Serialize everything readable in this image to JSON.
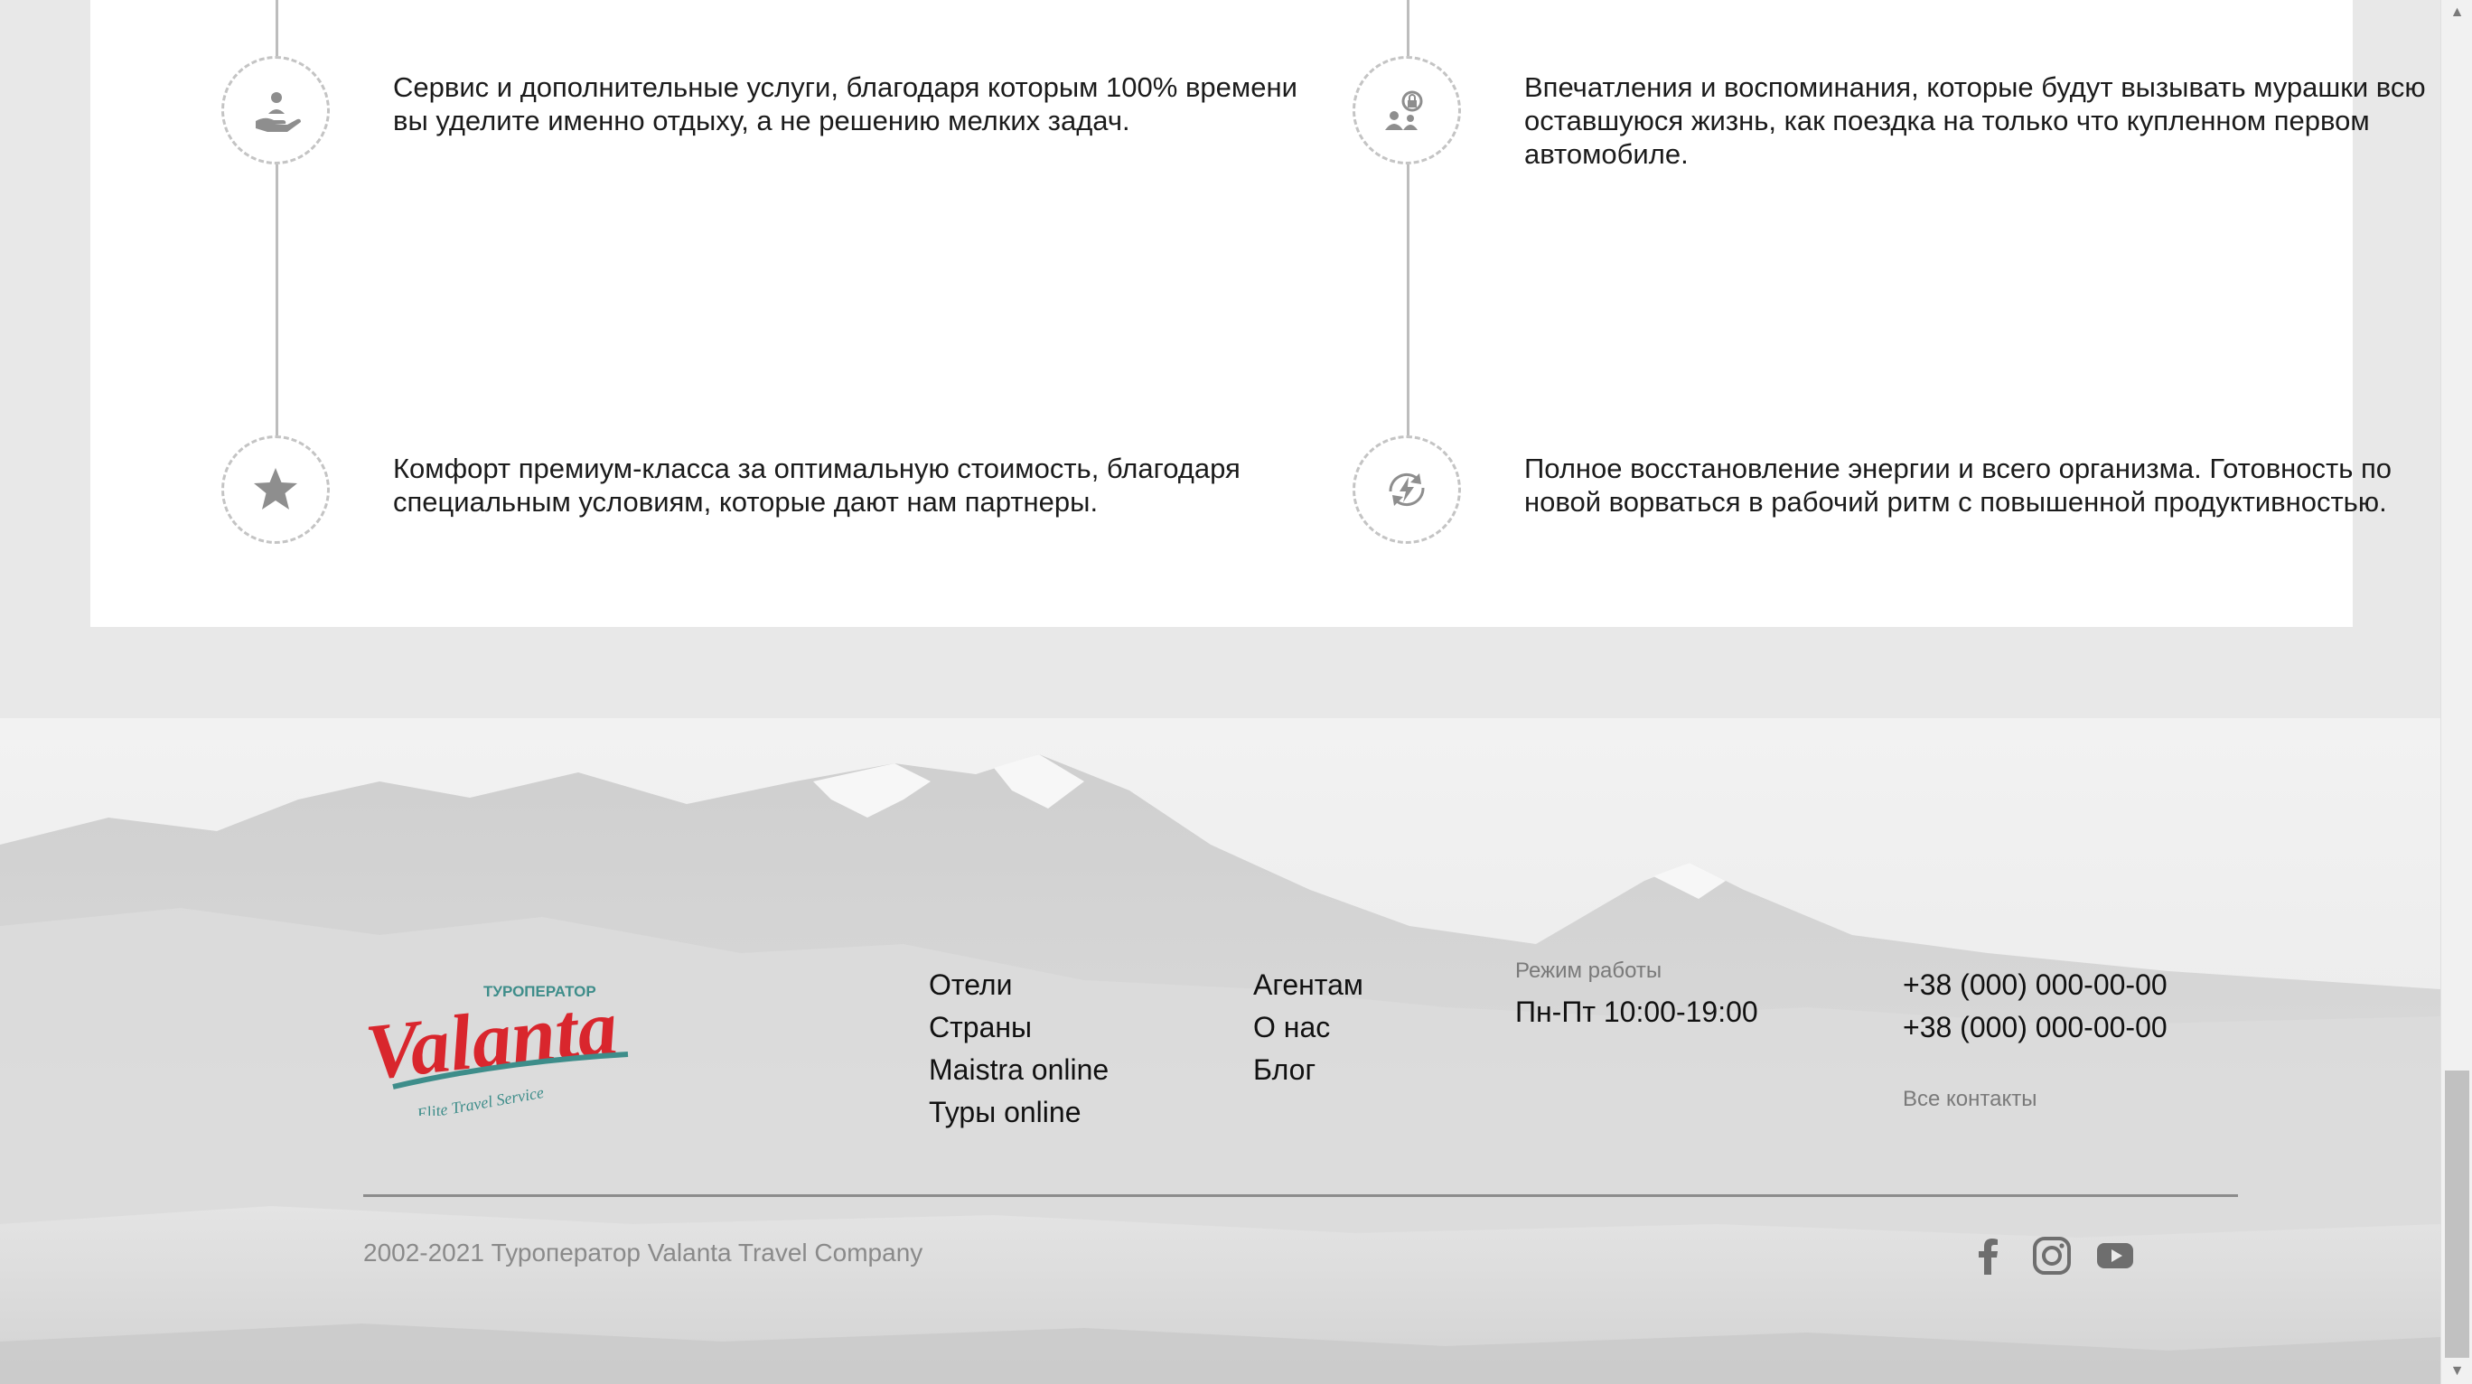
{
  "features": [
    {
      "icon": "hand-person-icon",
      "text": "Сервис и дополнительные услуги, благодаря которым 100% времени вы уделите именно отдыху, а не решению мелких задач."
    },
    {
      "icon": "people-lock-icon",
      "text": "Впечатления и воспоминания, которые будут вызывать мурашки всю оставшуюся жизнь, как поездка на только что купленном первом автомобиле."
    },
    {
      "icon": "star-icon",
      "text": "Комфорт премиум-класса за оптимальную стоимость, благодаря специальным условиям, которые дают нам партнеры."
    },
    {
      "icon": "energy-recharge-icon",
      "text": "Полное восстановление энергии и всего организма. Готовность по новой ворваться в рабочий ритм с повышенной продуктивностью."
    }
  ],
  "footer": {
    "logo": {
      "tagline_top": "ТУРОПЕРАТОР",
      "brand": "Valanta",
      "tagline_bottom": "Elite Travel Service",
      "brand_color": "#d9262d",
      "accent_color": "#3e8d8a"
    },
    "nav_col1": [
      "Отели",
      "Страны",
      "Maistra online",
      "Туры online"
    ],
    "nav_col2": [
      "Агентам",
      "О нас",
      "Блог"
    ],
    "hours_label": "Режим работы",
    "hours_value": "Пн-Пт 10:00-19:00",
    "phones": [
      "+38 (000) 000-00-00",
      "+38 (000) 000-00-00"
    ],
    "all_contacts": "Все контакты",
    "copyright": "2002-2021 Туроператор Valanta Travel Company",
    "social": [
      "facebook-icon",
      "instagram-icon",
      "youtube-icon"
    ]
  }
}
